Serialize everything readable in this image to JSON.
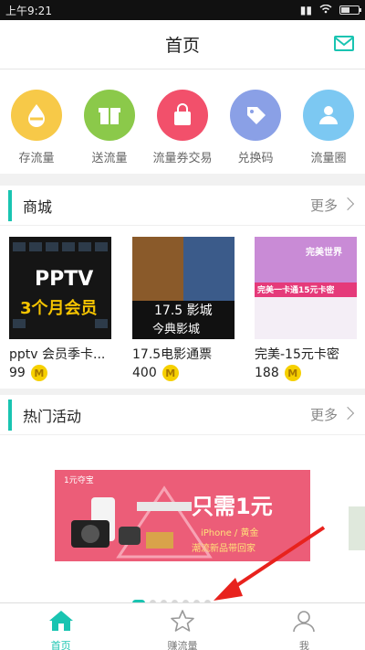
{
  "status": {
    "time": "上午9:21"
  },
  "header": {
    "title": "首页",
    "mail_icon": "mail-icon"
  },
  "quick_actions": [
    {
      "label": "存流量",
      "color": "#f7c948",
      "icon": "drop-icon"
    },
    {
      "label": "送流量",
      "color": "#8bc94a",
      "icon": "gift-icon"
    },
    {
      "label": "流量券交易",
      "color": "#f2506b",
      "icon": "bag-icon"
    },
    {
      "label": "兑换码",
      "color": "#8aa0e6",
      "icon": "tag-icon"
    },
    {
      "label": "流量圈",
      "color": "#7cc8f2",
      "icon": "people-icon"
    }
  ],
  "mall": {
    "title": "商城",
    "more": "更多",
    "products": [
      {
        "name": "pptv 会员季卡...",
        "price": "99",
        "img_text1": "PPTV",
        "img_text2": "3个月会员"
      },
      {
        "name": "17.5电影通票",
        "price": "400",
        "img_text1": "17.5 影城",
        "img_text2": "今典影城"
      },
      {
        "name": "完美-15元卡密",
        "price": "188",
        "img_text1": "完美世界",
        "img_text2": "完美一卡通15元卡密"
      }
    ],
    "coin_label": "M"
  },
  "hot": {
    "title": "热门活动",
    "more": "更多",
    "banner": {
      "brand": "1元夺宝",
      "headline": "只需1元",
      "line1": "iPhone / 黄金",
      "line2": "潮流新品带回家"
    },
    "page_count": 7,
    "active_page": 0
  },
  "tabs": [
    {
      "label": "首页",
      "icon": "home-icon",
      "active": true
    },
    {
      "label": "赚流量",
      "icon": "star-icon",
      "active": false
    },
    {
      "label": "我",
      "icon": "person-icon",
      "active": false
    }
  ],
  "colors": {
    "accent": "#19c4b1",
    "coin": "#f6d000",
    "banner": "#ec5d78",
    "arrow": "#e8221d"
  }
}
